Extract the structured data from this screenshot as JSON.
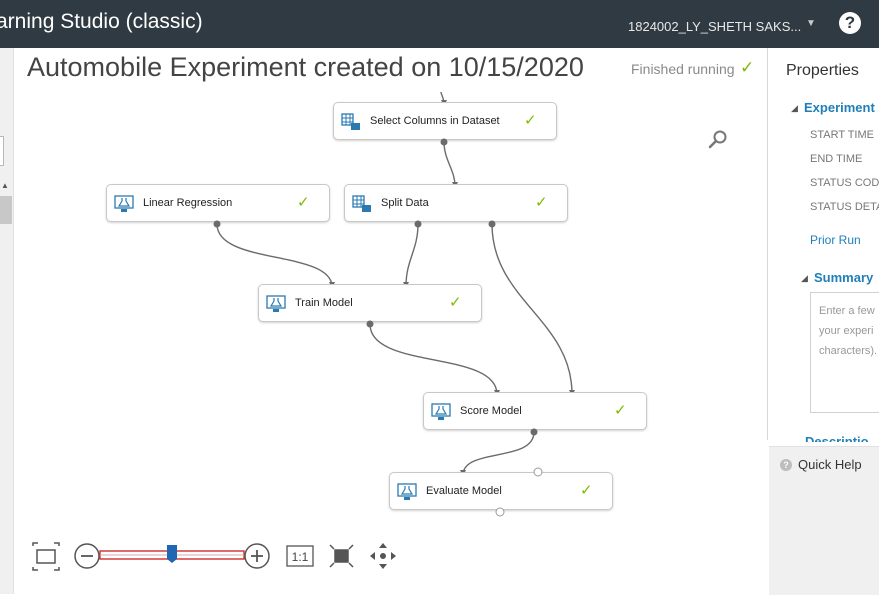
{
  "app": {
    "title": "arning Studio (classic)",
    "user": "1824002_LY_SHETH SAKS...",
    "help": "?"
  },
  "experiment": {
    "title": "Automobile Experiment created on 10/15/2020",
    "status": "Finished running"
  },
  "modules": [
    {
      "id": "select-columns",
      "label": "Select Columns in Dataset",
      "icon": "dataset-table-icon",
      "status": "done"
    },
    {
      "id": "linear-regression",
      "label": "Linear Regression",
      "icon": "flask-icon",
      "status": "done"
    },
    {
      "id": "split-data",
      "label": "Split Data",
      "icon": "dataset-table-icon",
      "status": "done"
    },
    {
      "id": "train-model",
      "label": "Train Model",
      "icon": "flask-icon",
      "status": "done"
    },
    {
      "id": "score-model",
      "label": "Score Model",
      "icon": "flask-icon",
      "status": "done"
    },
    {
      "id": "evaluate-model",
      "label": "Evaluate Model",
      "icon": "flask-icon",
      "status": "done"
    }
  ],
  "zoom": {
    "level": 0.5,
    "actual_size_label": "1:1"
  },
  "properties": {
    "title": "Properties",
    "experiment_section": "Experiment",
    "fields": [
      "START TIME",
      "END TIME",
      "STATUS COD",
      "STATUS DETA"
    ],
    "prior_run": "Prior Run",
    "summary_section": "Summary",
    "summary_placeholder": [
      "Enter a few",
      "your experi",
      "characters)."
    ],
    "description_section": "Descriptio"
  },
  "quick_help": {
    "label": "Quick Help"
  }
}
